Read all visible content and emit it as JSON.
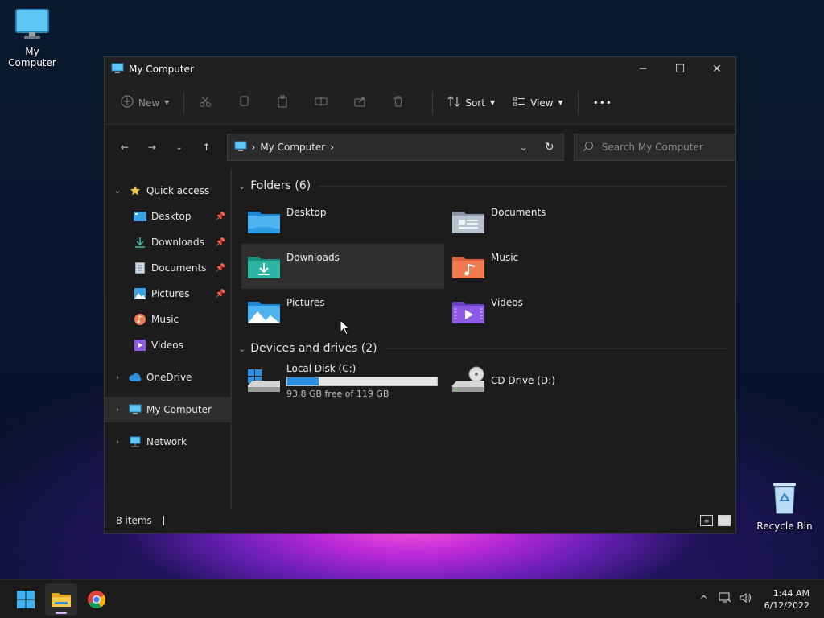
{
  "desktop": {
    "icons": [
      {
        "label": "My Computer"
      },
      {
        "label": "Recycle Bin"
      }
    ]
  },
  "window": {
    "title": "My Computer",
    "controls": {
      "minimize": "─",
      "maximize": "☐",
      "close": "✕"
    }
  },
  "toolbar": {
    "new_label": "New",
    "sort_label": "Sort",
    "view_label": "View",
    "more_label": "•••"
  },
  "address": {
    "crumb": "My Computer",
    "search_placeholder": "Search My Computer"
  },
  "sidebar": {
    "quick_access": "Quick access",
    "items": [
      {
        "label": "Desktop",
        "pinned": true
      },
      {
        "label": "Downloads",
        "pinned": true
      },
      {
        "label": "Documents",
        "pinned": true
      },
      {
        "label": "Pictures",
        "pinned": true
      },
      {
        "label": "Music",
        "pinned": false
      },
      {
        "label": "Videos",
        "pinned": false
      }
    ],
    "onedrive": "OneDrive",
    "my_computer": "My Computer",
    "network": "Network"
  },
  "content": {
    "folders_header": "Folders (6)",
    "folders": [
      "Desktop",
      "Documents",
      "Downloads",
      "Music",
      "Pictures",
      "Videos"
    ],
    "drives_header": "Devices and drives (2)",
    "drives": [
      {
        "name": "Local Disk (C:)",
        "free_text": "93.8 GB free of 119 GB",
        "used_fraction": 0.21
      },
      {
        "name": "CD Drive (D:)"
      }
    ]
  },
  "status": {
    "items_text": "8 items"
  },
  "taskbar": {
    "time": "1:44 AM",
    "date": "6/12/2022"
  },
  "colors": {
    "accent": "#2e8ee0",
    "folder_blue": "#4fb3f0",
    "folder_green": "#2bb5a2",
    "folder_orange": "#f07a50",
    "folder_purple": "#8d5ae6"
  }
}
